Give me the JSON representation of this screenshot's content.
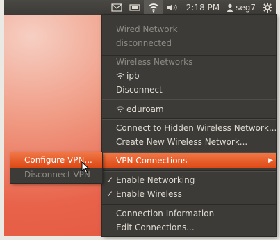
{
  "topbar": {
    "time": "2:18 PM",
    "user": "seg7",
    "icons": [
      "mail-icon",
      "keyboard-icon",
      "wifi-icon",
      "volume-icon",
      "user-icon",
      "gear-icon"
    ]
  },
  "menu": {
    "wired_header": "Wired Network",
    "wired_status": "disconnected",
    "wireless_header": "Wireless Networks",
    "network_ipb": "ipb",
    "disconnect": "Disconnect",
    "network_eduroam": "eduroam",
    "connect_hidden": "Connect to Hidden Wireless Network...",
    "create_new": "Create New Wireless Network...",
    "vpn_connections": "VPN Connections",
    "enable_networking": "Enable Networking",
    "enable_wireless": "Enable Wireless",
    "connection_info": "Connection Information",
    "edit_connections": "Edit Connections..."
  },
  "submenu": {
    "configure_vpn": "Configure VPN...",
    "disconnect_vpn": "Disconnect VPN"
  },
  "colors": {
    "panel": "#3c3b37",
    "highlight": "#dd4814",
    "text": "#dfdbd2",
    "disabled_text": "#8d8a83"
  }
}
